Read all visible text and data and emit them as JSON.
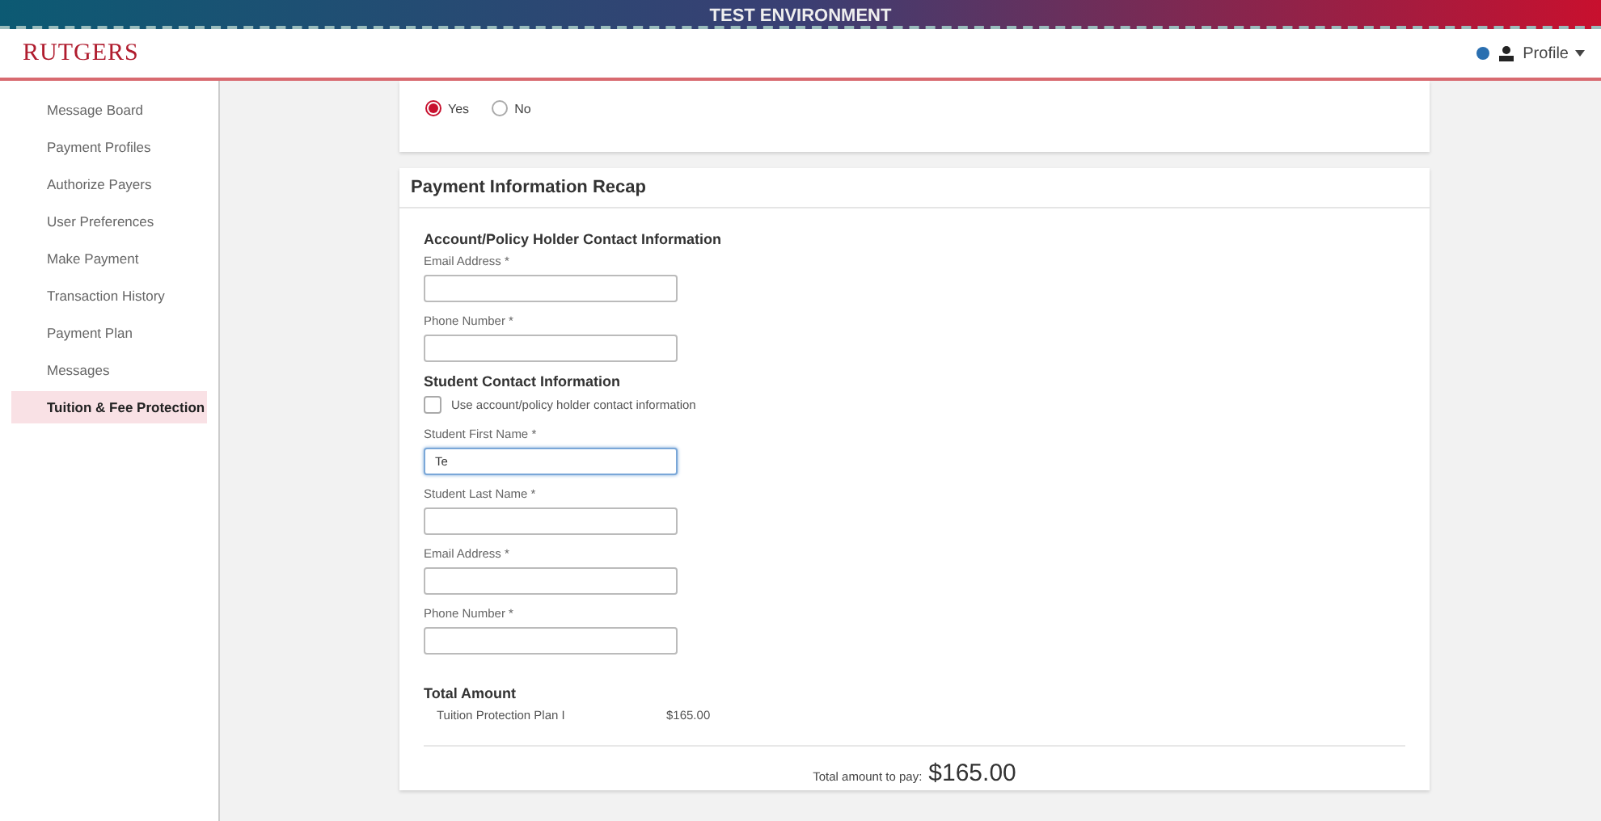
{
  "banner": {
    "text": "TEST ENVIRONMENT"
  },
  "header": {
    "logo": "RUTGERS",
    "profile": "Profile"
  },
  "sidebar": {
    "items": [
      {
        "label": "Message Board",
        "selected": false
      },
      {
        "label": "Payment Profiles",
        "selected": false
      },
      {
        "label": "Authorize Payers",
        "selected": false
      },
      {
        "label": "User Preferences",
        "selected": false
      },
      {
        "label": "Make Payment",
        "selected": false
      },
      {
        "label": "Transaction History",
        "selected": false
      },
      {
        "label": "Payment Plan",
        "selected": false
      },
      {
        "label": "Messages",
        "selected": false
      },
      {
        "label": "Tuition & Fee Protection",
        "selected": true
      }
    ]
  },
  "question": {
    "options": [
      {
        "label": "Yes",
        "selected": true
      },
      {
        "label": "No",
        "selected": false
      }
    ]
  },
  "recap": {
    "title": "Payment Information Recap",
    "sections": [
      {
        "heading": "Account/Policy Holder Contact Information",
        "fields": [
          {
            "label": "Email Address *",
            "focused": false
          },
          {
            "label": "Phone Number *",
            "focused": false
          }
        ]
      },
      {
        "heading": "Student Contact Information",
        "checkbox": {
          "label": "Use account/policy holder contact information",
          "checked": false
        },
        "fields": [
          {
            "label": "Student First Name *",
            "value": "Te",
            "focused": true
          },
          {
            "label": "Student Last Name *",
            "focused": false
          },
          {
            "label": "Email Address *",
            "focused": false
          },
          {
            "label": "Phone Number *",
            "focused": false
          }
        ]
      }
    ],
    "total": {
      "heading": "Total Amount",
      "lines": [
        {
          "item": "Tuition Protection Plan I",
          "amount": "$165.00"
        }
      ],
      "pay_label": "Total amount to pay:",
      "pay_amount": "$165.00"
    }
  }
}
